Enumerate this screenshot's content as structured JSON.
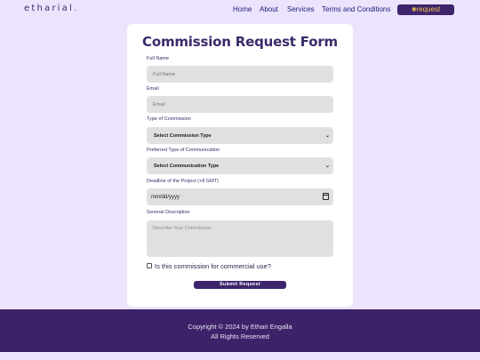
{
  "nav": {
    "logo_text": "etharial",
    "logo_dot": ".",
    "links": [
      "Home",
      "About",
      "Services",
      "Terms and Conditions"
    ],
    "request_label": "request",
    "request_icon": "pin-icon"
  },
  "form": {
    "title": "Commission Request Form",
    "full_name": {
      "label": "Full Name",
      "placeholder": "Full Name",
      "value": ""
    },
    "email": {
      "label": "Email",
      "placeholder": "Email",
      "value": ""
    },
    "commission_type": {
      "label": "Type of Commission",
      "selected": "Select Commission Type"
    },
    "communication_type": {
      "label": "Preferred Type of Communication",
      "selected": "Select Communication Type"
    },
    "deadline": {
      "label": "Deadline of the Project (+8 GMT)",
      "value": "mm/dd/yyyy"
    },
    "description": {
      "label": "General Description",
      "placeholder": "Describe Your Commission"
    },
    "commercial_checkbox": {
      "label": "Is this commission for commercial use?",
      "checked": false
    },
    "submit_label": "Submit Request"
  },
  "footer": {
    "copyright": "Copyright © 2024 by Ethari Engalla",
    "rights": "All Rights Reserved"
  },
  "colors": {
    "page_bg": "#ebe4fc",
    "accent": "#3d246c",
    "request_text": "#f2c24a",
    "footer_bg": "#3d2269"
  }
}
